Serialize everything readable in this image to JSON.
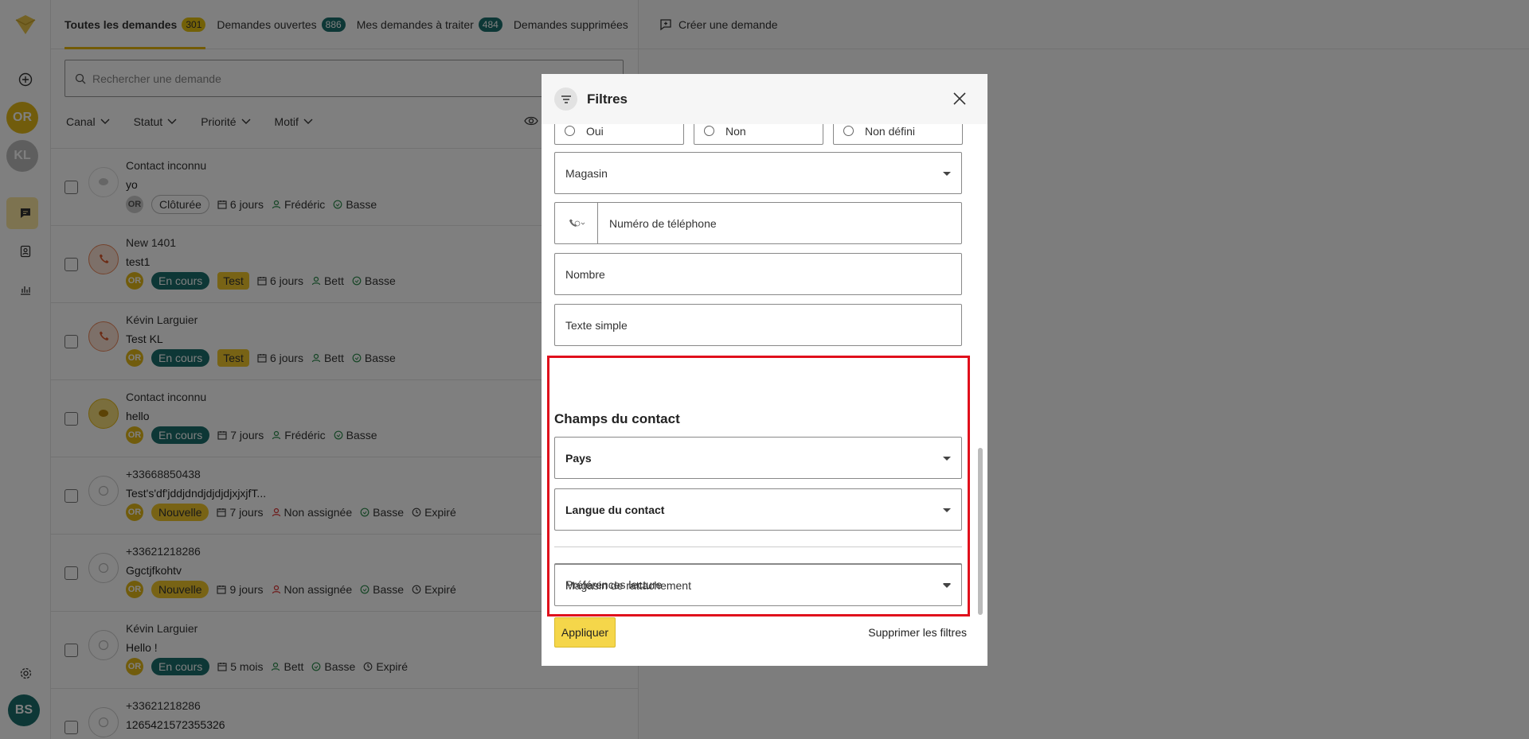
{
  "rail": {
    "avatars": [
      {
        "initials": "OR",
        "color": "#e3b818"
      },
      {
        "initials": "KL",
        "color": "#bdbdbd"
      }
    ],
    "user_avatar": {
      "initials": "BS",
      "color": "#1b6e6c"
    }
  },
  "tabs": [
    {
      "label": "Toutes les demandes",
      "count": "301",
      "active": true
    },
    {
      "label": "Demandes ouvertes",
      "count": "886"
    },
    {
      "label": "Mes demandes à traiter",
      "count": "484"
    },
    {
      "label": "Demandes supprimées",
      "count": ""
    }
  ],
  "search": {
    "placeholder": "Rechercher une demande"
  },
  "filters": [
    "Canal",
    "Statut",
    "Priorité",
    "Motif"
  ],
  "rows": [
    {
      "name": "Contact inconnu",
      "message": "yo",
      "avatar": "OR",
      "status": "Clôturée",
      "status_type": "closed",
      "tag": "",
      "time": "6 jours",
      "assignee": "Frédéric",
      "priority": "Basse",
      "expired": ""
    },
    {
      "name": "New 1401",
      "message": "test1",
      "avatar": "OR",
      "status": "En cours",
      "status_type": "progress",
      "tag": "Test",
      "time": "6 jours",
      "assignee": "Bett",
      "priority": "Basse",
      "expired": ""
    },
    {
      "name": "Kévin Larguier",
      "message": "Test KL",
      "avatar": "OR",
      "status": "En cours",
      "status_type": "progress",
      "tag": "Test",
      "time": "6 jours",
      "assignee": "Bett",
      "priority": "Basse",
      "expired": ""
    },
    {
      "name": "Contact inconnu",
      "message": "hello",
      "avatar": "OR",
      "status": "En cours",
      "status_type": "progress",
      "tag": "",
      "time": "7 jours",
      "assignee": "Frédéric",
      "priority": "Basse",
      "expired": ""
    },
    {
      "name": "+33668850438",
      "message": "Test's'df'jddjdndjdjdjdjxjxjfT...",
      "avatar": "OR",
      "status": "Nouvelle",
      "status_type": "new",
      "tag": "",
      "time": "7 jours",
      "assignee": "Non assignée",
      "priority": "Basse",
      "expired": "Expiré"
    },
    {
      "name": "+33621218286",
      "message": "Ggctjfkohtv",
      "avatar": "OR",
      "status": "Nouvelle",
      "status_type": "new",
      "tag": "",
      "time": "9 jours",
      "assignee": "Non assignée",
      "priority": "Basse",
      "expired": "Expiré"
    },
    {
      "name": "Kévin Larguier",
      "message": "Hello !",
      "avatar": "OR",
      "status": "En cours",
      "status_type": "progress",
      "tag": "",
      "time": "5 mois",
      "assignee": "Bett",
      "priority": "Basse",
      "expired": "Expiré"
    },
    {
      "name": "+33621218286",
      "message": "1265421572355326",
      "avatar": "",
      "status": "",
      "status_type": "",
      "tag": "",
      "time": "",
      "assignee": "",
      "priority": "",
      "expired": ""
    }
  ],
  "right": {
    "create_label": "Créer une demande"
  },
  "modal": {
    "title": "Filtres",
    "radio_options": [
      "Oui",
      "Non",
      "Non défini"
    ],
    "store_field": "Magasin",
    "phone_field": "Numéro de téléphone",
    "number_field": "Nombre",
    "text_field": "Texte simple",
    "contact_section": "Champs du contact",
    "country_field": "Pays",
    "language_field": "Langue du contact",
    "reading_pref_field": "Préférences lecture",
    "home_store_field": "Magasin de rattachement",
    "apply_label": "Appliquer",
    "clear_label": "Supprimer les filtres"
  },
  "colors": {
    "accent": "#f5d64a",
    "teal": "#1b6e6c",
    "highlight": "#e0101c"
  }
}
